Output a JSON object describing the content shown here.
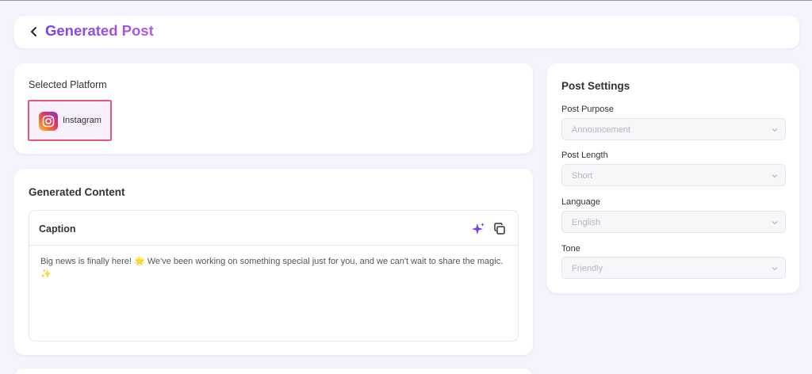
{
  "header": {
    "title": "Generated Post"
  },
  "platform": {
    "section_label": "Selected Platform",
    "selected": {
      "name": "Instagram",
      "icon": "instagram-icon"
    }
  },
  "content": {
    "section_title": "Generated Content",
    "caption": {
      "title": "Caption",
      "text": "Big news is finally here! 🌟 We've been working on something special just for you, and we can't wait to share the magic. ✨",
      "actions": [
        "sparkle-icon",
        "copy-icon"
      ]
    }
  },
  "settings": {
    "title": "Post Settings",
    "fields": [
      {
        "label": "Post Purpose",
        "value": "Announcement"
      },
      {
        "label": "Post Length",
        "value": "Short"
      },
      {
        "label": "Language",
        "value": "English"
      },
      {
        "label": "Tone",
        "value": "Friendly"
      }
    ]
  },
  "colors": {
    "accent": "#7a3fe8",
    "selected_border": "#e05a78",
    "background": "#f5f3fd"
  }
}
